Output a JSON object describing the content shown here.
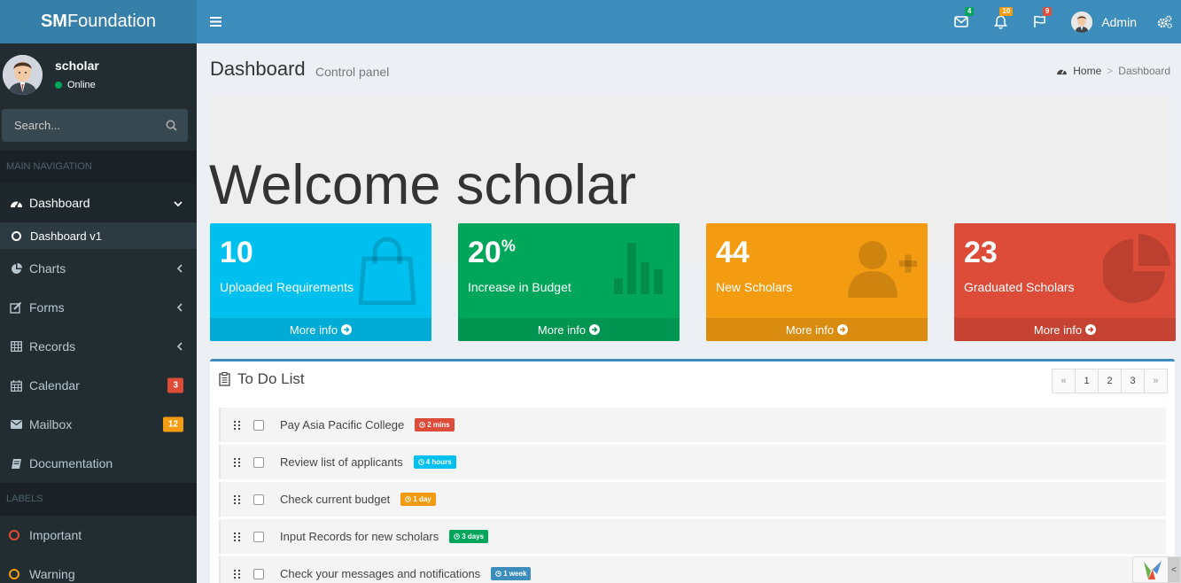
{
  "brand": {
    "bold": "SM",
    "rest": "Foundation"
  },
  "header": {
    "messages_count": "4",
    "notifications_count": "10",
    "tasks_count": "9",
    "user_name": "Admin",
    "colors": {
      "header": "#3c8dbc",
      "logo": "#367fa9"
    }
  },
  "sidebar": {
    "user_name": "scholar",
    "user_status": "Online",
    "search_placeholder": "Search...",
    "main_nav_header": "MAIN NAVIGATION",
    "items": [
      {
        "label": "Dashboard",
        "icon": "dashboard-icon"
      },
      {
        "label": "Dashboard v1",
        "icon": "circle-icon"
      },
      {
        "label": "Charts",
        "icon": "pie-chart-icon"
      },
      {
        "label": "Forms",
        "icon": "edit-icon"
      },
      {
        "label": "Records",
        "icon": "table-icon"
      },
      {
        "label": "Calendar",
        "icon": "calendar-icon",
        "badge": "3"
      },
      {
        "label": "Mailbox",
        "icon": "envelope-icon",
        "badge": "12"
      },
      {
        "label": "Documentation",
        "icon": "book-icon"
      }
    ],
    "labels_header": "LABELS",
    "labels": [
      {
        "label": "Important",
        "color": "#dd4b39"
      },
      {
        "label": "Warning",
        "color": "#f39c12"
      }
    ]
  },
  "page": {
    "title": "Dashboard",
    "subtitle": "Control panel",
    "breadcrumb_home": "Home",
    "breadcrumb_current": "Dashboard",
    "welcome": "Welcome scholar"
  },
  "stats": [
    {
      "value": "10",
      "sup": "",
      "label": "Uploaded Requirements",
      "footer": "More info",
      "icon": "shopping-bag-icon",
      "color": "#00c0ef"
    },
    {
      "value": "20",
      "sup": "%",
      "label": "Increase in Budget",
      "footer": "More info",
      "icon": "bar-chart-icon",
      "color": "#00a65a"
    },
    {
      "value": "44",
      "sup": "",
      "label": "New Scholars",
      "footer": "More info",
      "icon": "user-plus-icon",
      "color": "#f39c12"
    },
    {
      "value": "23",
      "sup": "",
      "label": "Graduated Scholars",
      "footer": "More info",
      "icon": "pie-chart-icon",
      "color": "#dd4b39"
    }
  ],
  "todo": {
    "title": "To Do List",
    "pager": [
      "«",
      "1",
      "2",
      "3",
      "»"
    ],
    "items": [
      {
        "text": "Pay Asia Pacific College",
        "time": "2 mins",
        "color": "#dd4b39"
      },
      {
        "text": "Review list of applicants",
        "time": "4 hours",
        "color": "#00c0ef"
      },
      {
        "text": "Check current budget",
        "time": "1 day",
        "color": "#f39c12"
      },
      {
        "text": "Input Records for new scholars",
        "time": "3 days",
        "color": "#00a65a"
      },
      {
        "text": "Check your messages and notifications",
        "time": "1 week",
        "color": "#3c8dbc"
      }
    ]
  }
}
